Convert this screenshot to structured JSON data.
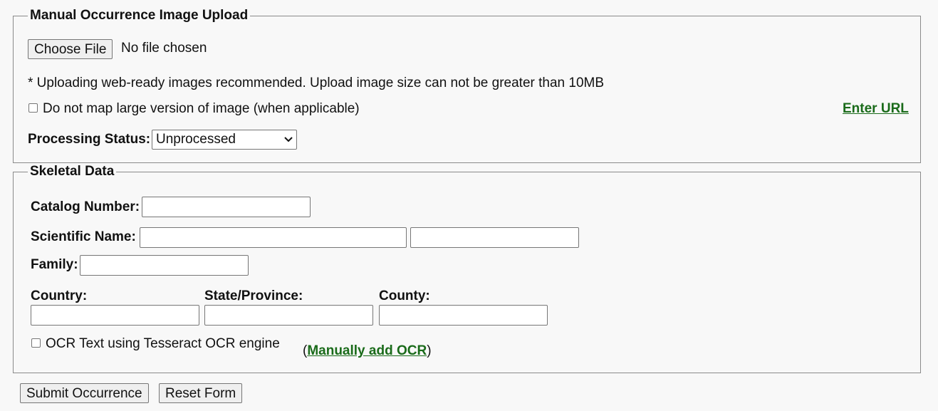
{
  "image_upload": {
    "legend": "Manual Occurrence Image Upload",
    "choose_file_label": "Choose File",
    "file_status": "No file chosen",
    "note": "* Uploading web-ready images recommended. Upload image size can not be greater than 10MB",
    "no_large_checkbox_label": "Do not map large version of image (when applicable)",
    "enter_url_link": "Enter URL",
    "processing_status_label": "Processing Status:",
    "processing_status_value": "Unprocessed"
  },
  "skeletal_data": {
    "legend": "Skeletal Data",
    "catalog_number_label": "Catalog Number:",
    "catalog_number_value": "",
    "scientific_name_label": "Scientific Name:",
    "scientific_name_value": "",
    "author_value": "",
    "family_label": "Family:",
    "family_value": "",
    "country_label": "Country:",
    "country_value": "",
    "state_label": "State/Province:",
    "state_value": "",
    "county_label": "County:",
    "county_value": "",
    "ocr_checkbox_label": "OCR Text using Tesseract OCR engine",
    "manual_ocr_open": "(",
    "manual_ocr_link": "Manually add OCR",
    "manual_ocr_close": ")"
  },
  "actions": {
    "submit_label": "Submit Occurrence",
    "reset_label": "Reset Form"
  }
}
